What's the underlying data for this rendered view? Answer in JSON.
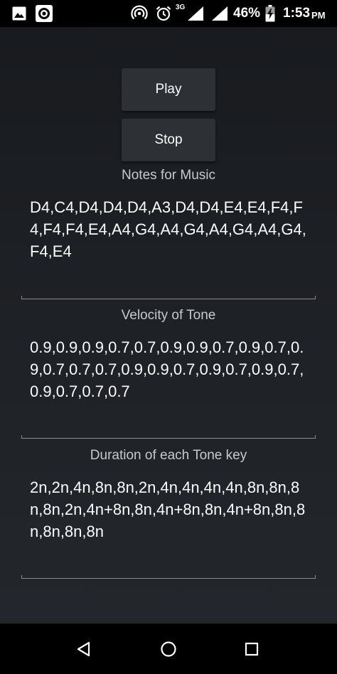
{
  "status_bar": {
    "left_icons": [
      "image-icon",
      "record-icon"
    ],
    "network_type": "3G",
    "battery_percent": "46%",
    "time": "1:53",
    "ampm": "PM"
  },
  "buttons": {
    "play_label": "Play",
    "stop_label": "Stop"
  },
  "fields": {
    "notes": {
      "label": "Notes for Music",
      "value": "D4,C4,D4,D4,D4,A3,D4,D4,E4,E4,F4,F4,F4,F4,E4,A4,G4,A4,G4,A4,G4,A4,G4,F4,E4"
    },
    "velocity": {
      "label": "Velocity of Tone",
      "value": "0.9,0.9,0.9,0.7,0.7,0.9,0.9,0.7,0.9,0.7,0.9,0.7,0.7,0.7,0.9,0.9,0.7,0.9,0.7,0.9,0.7,0.9,0.7,0.7,0.7"
    },
    "duration": {
      "label": "Duration of each Tone key",
      "value": "2n,2n,4n,8n,8n,2n,4n,4n,4n,4n,8n,8n,8n,8n,2n,4n+8n,8n,4n+8n,8n,4n+8n,8n,8n,8n,8n,8n"
    }
  },
  "nav_bar": {
    "icons": [
      "back-icon",
      "home-icon",
      "recents-icon"
    ]
  },
  "colors": {
    "background": "#1d2024",
    "button": "#2d3034",
    "label": "#c7c9cc",
    "underline": "#8a8d91"
  }
}
